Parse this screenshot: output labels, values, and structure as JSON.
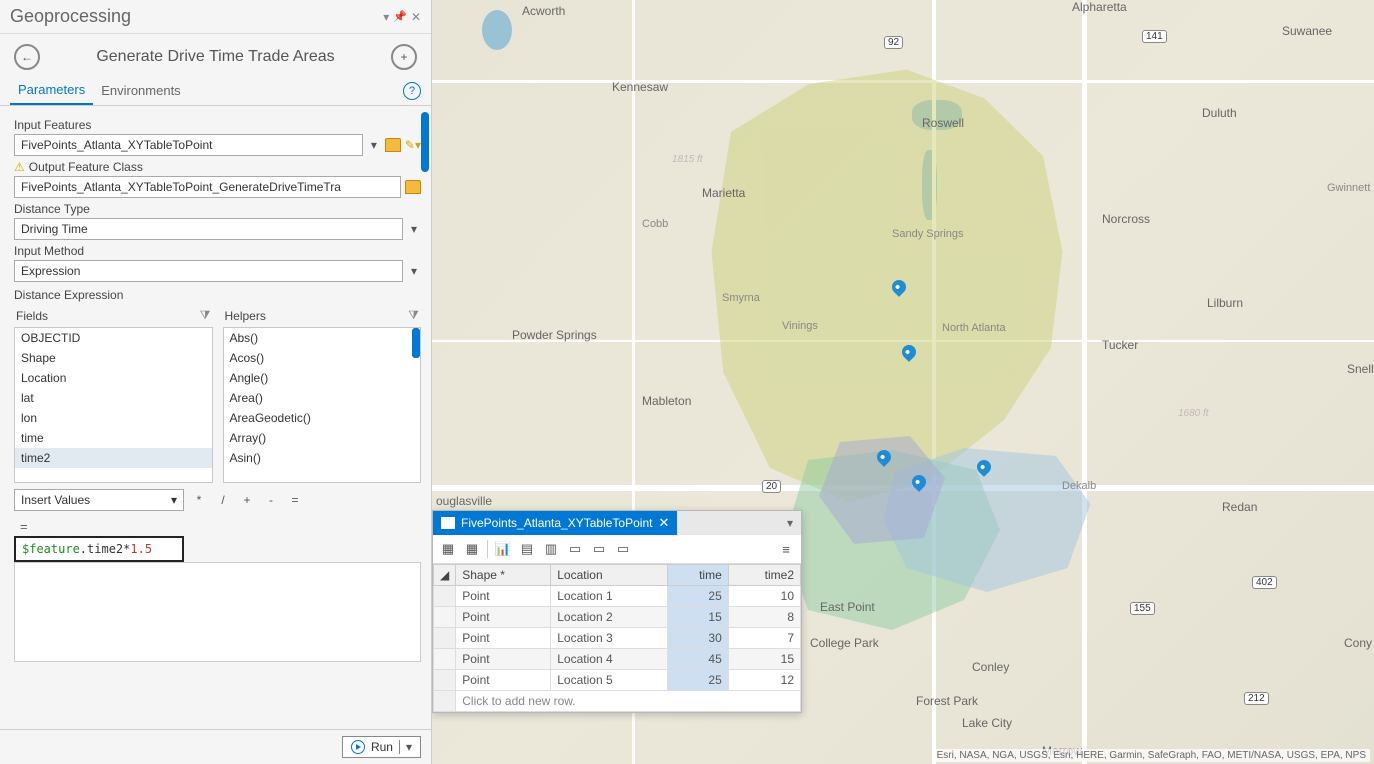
{
  "panel": {
    "title": "Geoprocessing",
    "tool_name": "Generate Drive Time Trade Areas",
    "tabs": {
      "parameters": "Parameters",
      "environments": "Environments"
    },
    "params": {
      "input_features_label": "Input Features",
      "input_features_value": "FivePoints_Atlanta_XYTableToPoint",
      "output_fc_label": "Output Feature Class",
      "output_fc_value": "FivePoints_Atlanta_XYTableToPoint_GenerateDriveTimeTra",
      "distance_type_label": "Distance Type",
      "distance_type_value": "Driving Time",
      "input_method_label": "Input Method",
      "input_method_value": "Expression",
      "distance_expression_label": "Distance Expression",
      "fields_label": "Fields",
      "helpers_label": "Helpers",
      "fields": [
        "OBJECTID",
        "Shape",
        "Location",
        "lat",
        "lon",
        "time",
        "time2"
      ],
      "helpers": [
        "Abs()",
        "Acos()",
        "Angle()",
        "Area()",
        "AreaGeodetic()",
        "Array()",
        "Asin()"
      ],
      "insert_values_label": "Insert Values",
      "expr_prefix": "$feature",
      "expr_rest": ".time2*",
      "expr_num": "1.5",
      "eq": "="
    },
    "run_label": "Run"
  },
  "table": {
    "tab_title": "FivePoints_Atlanta_XYTableToPoint",
    "columns": [
      "Shape *",
      "Location",
      "time",
      "time2"
    ],
    "rows": [
      {
        "shape": "Point",
        "location": "Location 1",
        "time": 25,
        "time2": 10
      },
      {
        "shape": "Point",
        "location": "Location 2",
        "time": 15,
        "time2": 8
      },
      {
        "shape": "Point",
        "location": "Location 3",
        "time": 30,
        "time2": 7
      },
      {
        "shape": "Point",
        "location": "Location 4",
        "time": 45,
        "time2": 15
      },
      {
        "shape": "Point",
        "location": "Location 5",
        "time": 25,
        "time2": 12
      }
    ],
    "new_row_text": "Click to add new row."
  },
  "map": {
    "labels": {
      "acworth": "Acworth",
      "alpharetta": "Alpharetta",
      "suwanee": "Suwanee",
      "kennesaw": "Kennesaw",
      "roswell": "Roswell",
      "duluth": "Duluth",
      "marietta": "Marietta",
      "gwinnett": "Gwinnett",
      "cobb": "Cobb",
      "sandy": "Sandy Springs",
      "norcross": "Norcross",
      "lilburn": "Lilburn",
      "powder": "Powder Springs",
      "smyrna": "Smyrna",
      "vinings": "Vinings",
      "northatl": "North Atlanta",
      "tucker": "Tucker",
      "snell": "Snell",
      "mableton": "Mableton",
      "douglasville": "ouglasville",
      "dekalb": "Dekalb",
      "redan": "Redan",
      "eastpoint": "East Point",
      "collegepark": "College Park",
      "conley": "Conley",
      "forestpark": "Forest Park",
      "lakecity": "Lake City",
      "morrow": "Morrow",
      "cony": "Cony"
    },
    "contour1": "1815 ft",
    "contour2": "1680 ft",
    "shields": {
      "s92": "92",
      "s141": "141",
      "s20": "20",
      "s155": "155",
      "s402": "402",
      "s212": "212"
    },
    "attribution": "Esri, NASA, NGA, USGS, Esri, HERE, Garmin, SafeGraph, FAO, METI/NASA, USGS, EPA, NPS"
  }
}
